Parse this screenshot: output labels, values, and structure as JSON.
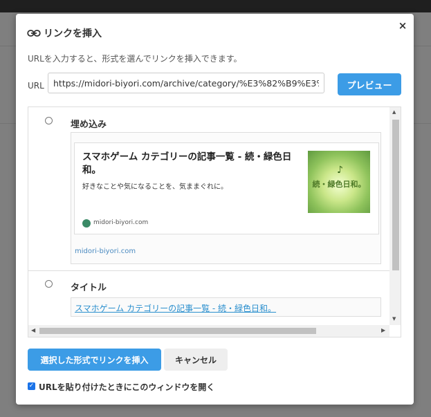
{
  "dialog": {
    "title": "リンクを挿入",
    "close_symbol": "×",
    "description": "URLを入力すると、形式を選んでリンクを挿入できます。",
    "url_label": "URL",
    "url_value": "https://midori-biyori.com/archive/category/%E3%82%B9%E3%83",
    "preview_label": "プレビュー",
    "options": [
      {
        "label": "埋め込み",
        "card": {
          "title": "スマホゲーム カテゴリーの記事一覧 - 続・緑色日和。",
          "description": "好きなことや気になることを、気ままぐれに。",
          "site_small": "midori-biyori.com",
          "thumb_title": "続・緑色日和。",
          "thumb_note": "♪",
          "site_link": "midori-biyori.com"
        }
      },
      {
        "label": "タイトル",
        "link_text": "スマホゲーム カテゴリーの記事一覧 - 続・緑色日和。"
      }
    ],
    "insert_label": "選択した形式でリンクを挿入",
    "cancel_label": "キャンセル",
    "checkbox_checked": true,
    "checkbox_label": "URLを貼り付けたときにこのウィンドウを開く"
  },
  "icons": {
    "link": "link-icon",
    "close": "close-icon",
    "favicon": "favicon-icon"
  }
}
